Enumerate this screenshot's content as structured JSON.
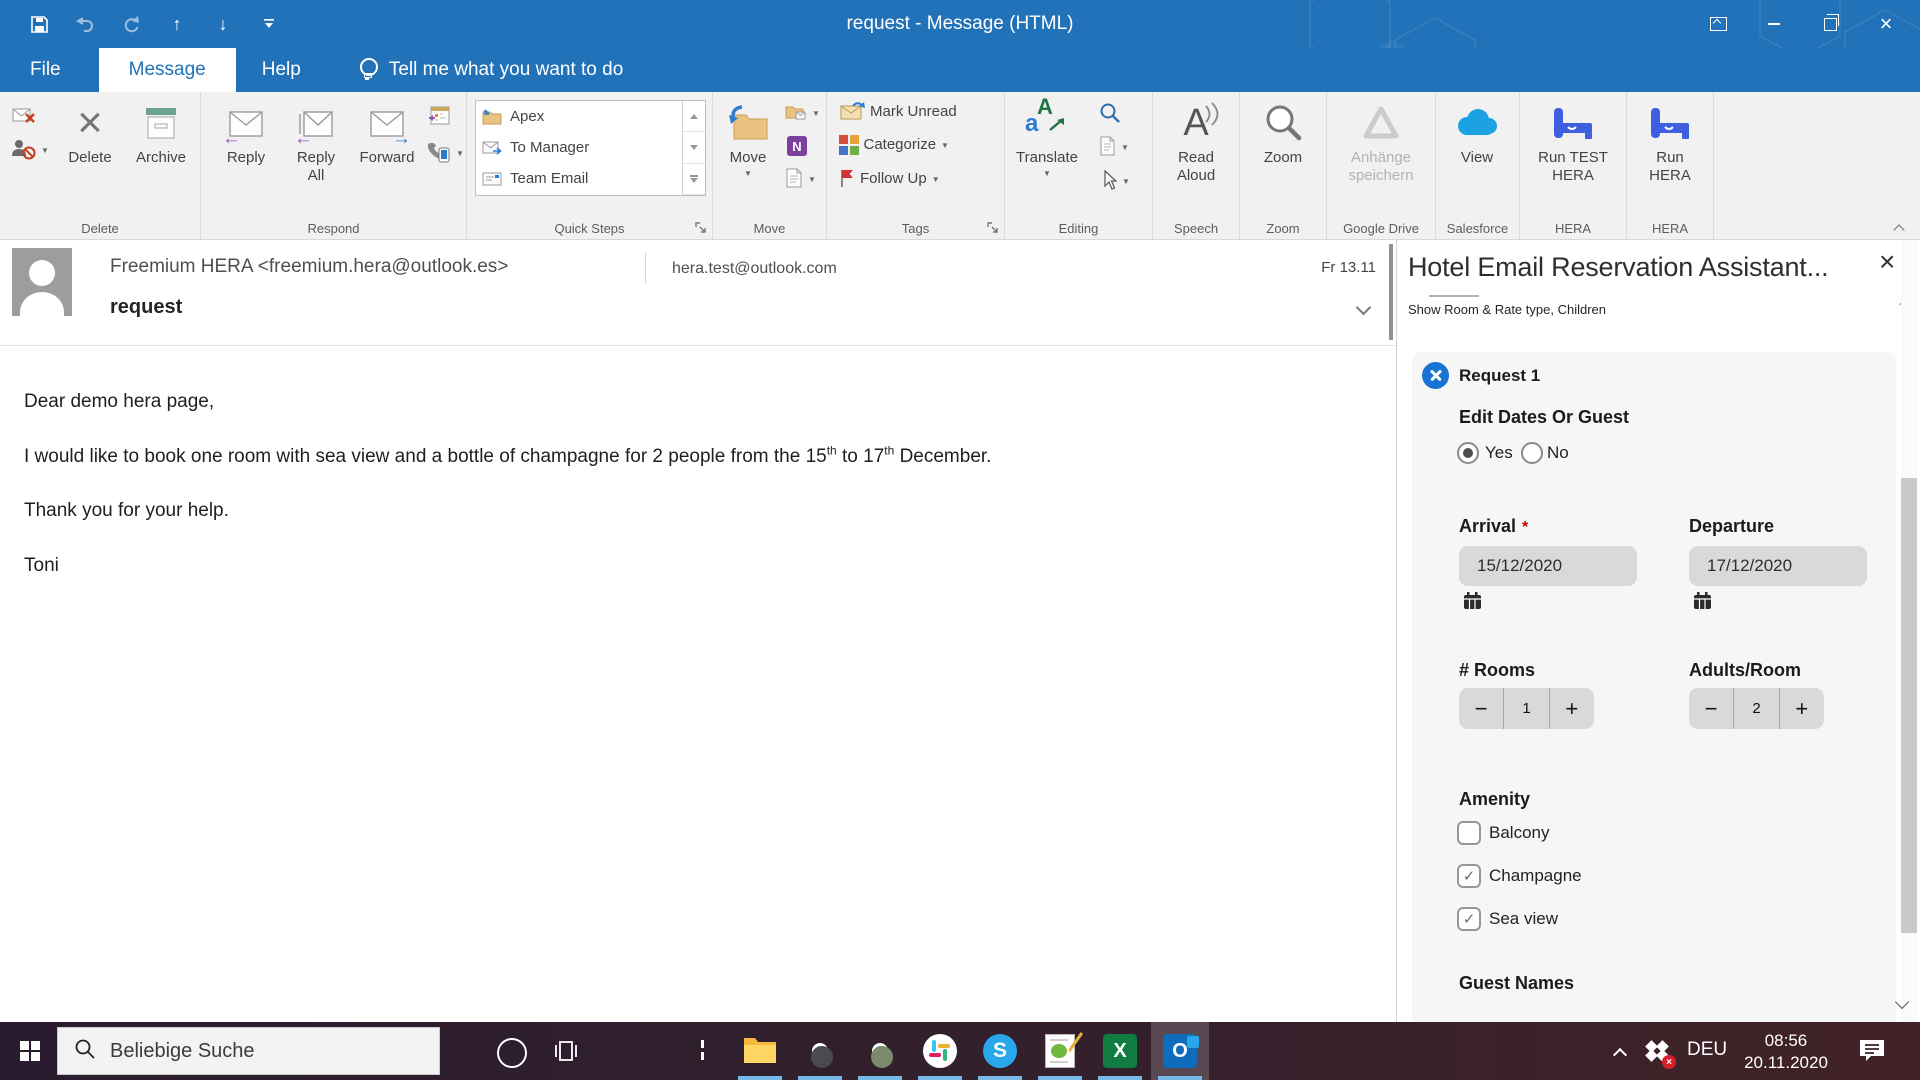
{
  "colors": {
    "titlebar_blue": "#2272b9",
    "hera_blue": "#3d5fe0",
    "salesforce_blue": "#1ca2e3",
    "request_icon_blue": "#1973d4",
    "taskbar_underline": "#76b9e8"
  },
  "icons": {
    "check": "✓",
    "close_x": "×",
    "dropdown": "▼",
    "up_arrow": "↑",
    "down_arrow": "↓",
    "reply_arrow": "←",
    "forward_arrow": "→",
    "minus": "−",
    "plus": "+",
    "asterisk": "*"
  },
  "titlebar": {
    "title": "request  -  Message (HTML)"
  },
  "tabs": {
    "file": "File",
    "message": "Message",
    "help": "Help",
    "tell_me": "Tell me what you want to do"
  },
  "ribbon": {
    "groups": {
      "delete": {
        "label": "Delete",
        "delete": "Delete",
        "archive": "Archive"
      },
      "respond": {
        "label": "Respond",
        "reply": "Reply",
        "reply_all": "Reply\nAll",
        "forward": "Forward"
      },
      "quick_steps": {
        "label": "Quick Steps",
        "items": [
          "Apex",
          "To Manager",
          "Team Email"
        ]
      },
      "move": {
        "label": "Move",
        "move": "Move"
      },
      "tags": {
        "label": "Tags",
        "mark_unread": "Mark Unread",
        "categorize": "Categorize",
        "follow_up": "Follow Up"
      },
      "editing": {
        "label": "Editing",
        "translate": "Translate"
      },
      "speech": {
        "label": "Speech",
        "read_aloud": "Read\nAloud"
      },
      "zoom": {
        "label": "Zoom",
        "zoom": "Zoom"
      },
      "google_drive": {
        "label": "Google Drive",
        "save_attachments": "Anhänge\nspeichern"
      },
      "salesforce": {
        "label": "Salesforce",
        "view": "View"
      },
      "hera_test": {
        "label": "HERA",
        "run_test": "Run TEST\nHERA"
      },
      "hera": {
        "label": "HERA",
        "run": "Run\nHERA"
      }
    }
  },
  "email": {
    "sender": "Freemium HERA <freemium.hera@outlook.es>",
    "recipient": "hera.test@outlook.com",
    "date": "Fr 13.11",
    "subject": "request",
    "body": {
      "greeting": "Dear demo hera page,",
      "line1_parts": [
        "I would like to book one room with sea view and a bottle of champagne for 2 people from the 15",
        "th",
        " to 17",
        "th",
        " December."
      ],
      "thanks": "Thank you for your help.",
      "signature": "Toni"
    }
  },
  "panel": {
    "title": "Hotel Email Reservation Assistant...",
    "subtitle": "Show Room & Rate type, Children",
    "request_label": "Request 1",
    "edit_dates": {
      "label": "Edit Dates Or Guest",
      "yes": "Yes",
      "no": "No",
      "selected": "Yes"
    },
    "arrival": {
      "label": "Arrival",
      "value": "15/12/2020",
      "required": "*"
    },
    "departure": {
      "label": "Departure",
      "value": "17/12/2020"
    },
    "rooms": {
      "label": "# Rooms",
      "value": "1"
    },
    "adults": {
      "label": "Adults/Room",
      "value": "2"
    },
    "amenity": {
      "label": "Amenity",
      "options": [
        {
          "label": "Balcony",
          "checked": false
        },
        {
          "label": "Champagne",
          "checked": true
        },
        {
          "label": "Sea view",
          "checked": true
        }
      ]
    },
    "guest_names_label": "Guest Names"
  },
  "taskbar": {
    "search_text": "Beliebige Suche",
    "language": "DEU",
    "time": "08:56",
    "date": "20.11.2020",
    "apps": [
      "file-explorer",
      "chrome-profile-1",
      "chrome-profile-2",
      "slack",
      "skype",
      "notepad-plus",
      "excel",
      "outlook"
    ]
  }
}
